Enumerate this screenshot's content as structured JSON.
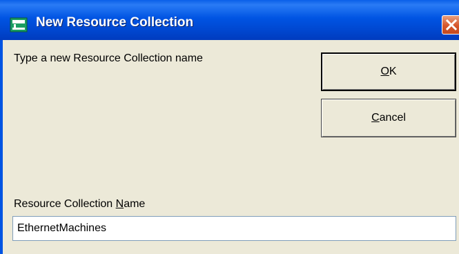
{
  "window": {
    "title": "New Resource Collection",
    "title_icon": "resource-collection-icon",
    "close_icon": "close-icon"
  },
  "dialog": {
    "prompt": "Type a new Resource Collection name",
    "ok_button": {
      "accel": "O",
      "rest": "K"
    },
    "cancel_button": {
      "accel": "C",
      "rest": "ancel"
    },
    "name_label": {
      "before": "Resource Collection ",
      "accel": "N",
      "after": "ame"
    },
    "name_value": "EthernetMachines"
  },
  "colors": {
    "titlebar": "#0054E3",
    "dialog_bg": "#ECE9D8",
    "close_button": "#D6562C"
  }
}
